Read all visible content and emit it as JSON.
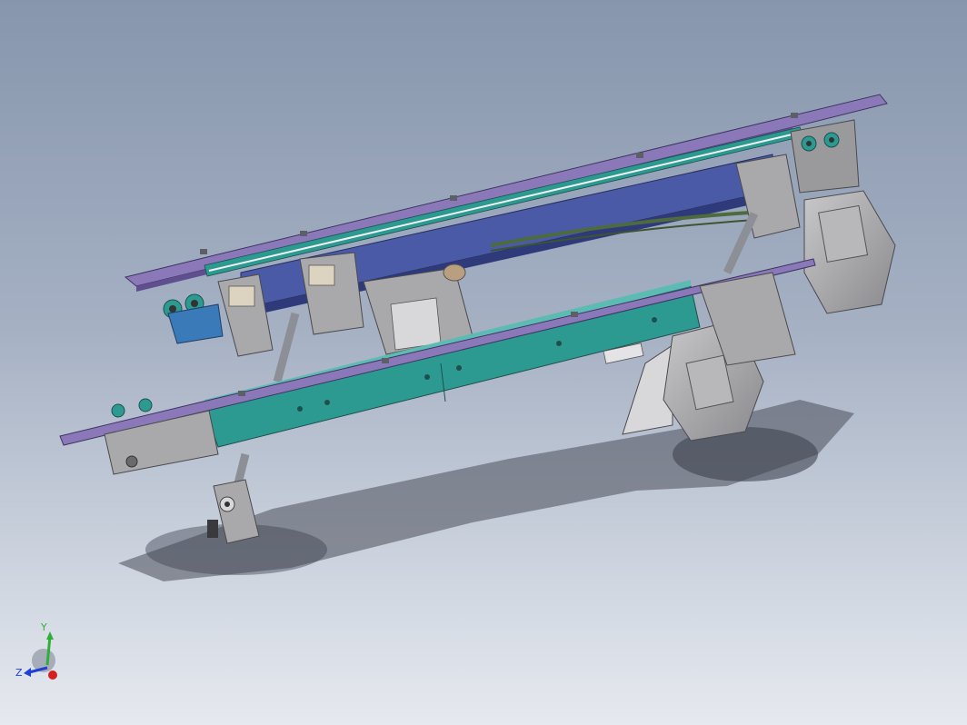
{
  "app": {
    "name": "",
    "view": "isometric"
  },
  "triad": {
    "y_label": "Y",
    "z_label": "Z",
    "colors": {
      "y": "#2fae3a",
      "z": "#1f3fd6",
      "x": "#d41f1f"
    }
  },
  "model": {
    "colors": {
      "cover_plate": "#8a78b8",
      "beam_teal": "#2c9a91",
      "beam_blue": "#4b5aa6",
      "steel_gray": "#a9a9ab",
      "dark_gray": "#5d5f66",
      "belt_green": "#4d6b3c",
      "shadow": "#4a4e5a"
    }
  }
}
